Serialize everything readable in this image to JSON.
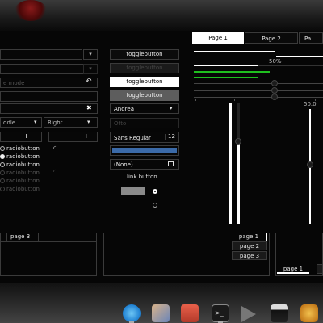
{
  "notebook_top": {
    "tabs": [
      "Page 1",
      "Page 2",
      "Pa"
    ]
  },
  "left": {
    "entry_mode_placeholder": "e mode",
    "combo_middle": "ddle",
    "combo_right": "Right",
    "spin_minus": "−",
    "spin_plus": "+",
    "radios": [
      "radiobutton",
      "radiobutton",
      "radiobutton",
      "radiobutton",
      "radiobutton",
      "radiobutton"
    ]
  },
  "middle": {
    "toggles": [
      "togglebutton",
      "togglebutton",
      "togglebutton",
      "togglebutton"
    ],
    "combo_andrea": "Andrea",
    "combo_otto": "Otto",
    "font_name": "Sans Regular",
    "font_size": "12",
    "file_chooser": "(None)",
    "link_button": "link button",
    "color_swatch": "#3b6aa8"
  },
  "right": {
    "progress_label": "50%",
    "scale_value": "50.0",
    "progress_fraction": 0.5
  },
  "bottom": {
    "left_tab": "page 3",
    "side_tabs": [
      "page 1",
      "page 2",
      "page 3"
    ],
    "bottom_tabs": [
      "page 1"
    ]
  },
  "colors": {
    "accent_green": "#1fbf1f",
    "swatch": "#3b6aa8"
  },
  "dock_icons": [
    "browser-icon",
    "mail-icon",
    "archive-icon",
    "terminal-icon",
    "media-player-icon",
    "video-editor-icon",
    "music-icon"
  ]
}
